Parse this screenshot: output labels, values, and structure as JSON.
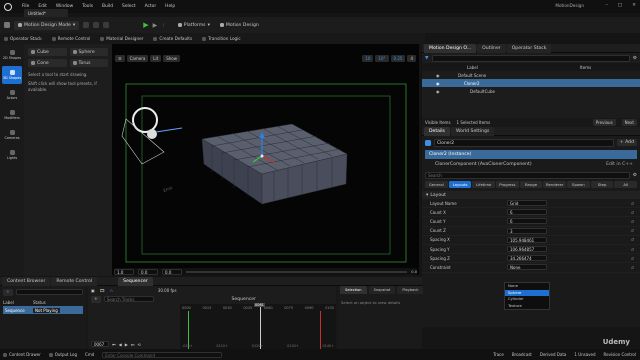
{
  "window": {
    "title": "MotionDesign",
    "doc_tab": "Untitled*"
  },
  "menu": [
    "File",
    "Edit",
    "Window",
    "Tools",
    "Build",
    "Select",
    "Actor",
    "Help"
  ],
  "toolbar": {
    "mode": "Motion Design Mode",
    "platforms": "Platforms",
    "motion_design": "Motion Design"
  },
  "toolbar2": {
    "operator_stack": "Operator Stack",
    "remote_control": "Remote Control",
    "material_designer": "Material Designer",
    "create_defaults": "Create Defaults",
    "transition_logic": "Transition Logic"
  },
  "left_tools": [
    {
      "label": "2D Shapes",
      "icon": "shapes-2d-icon"
    },
    {
      "label": "3D Shapes",
      "icon": "shapes-3d-icon",
      "active": true
    },
    {
      "label": "Actors",
      "icon": "actors-icon"
    },
    {
      "label": "Modifiers",
      "icon": "modifiers-icon"
    },
    {
      "label": "Cameras",
      "icon": "camera-icon"
    },
    {
      "label": "Lights",
      "icon": "light-icon"
    }
  ],
  "shape_buttons": [
    "Cube",
    "Sphere",
    "Cone",
    "Torus"
  ],
  "tool_hint": {
    "line1": "Select a tool to start drawing.",
    "line2": "Shift click will show tool presets, if available."
  },
  "viewport": {
    "camera": "Camera",
    "lit": "Lit",
    "show": "Show",
    "grid": "10",
    "rot": "10°",
    "scale": "0.25",
    "cam_speed": "4",
    "timeline": {
      "start": "1.0",
      "mid": "0.0",
      "sub": "0.0",
      "fps": "0.0"
    },
    "label_3d": "Emit"
  },
  "outliner": {
    "tabs": [
      "Motion Design O...",
      "Outliner",
      "Operator Stack"
    ],
    "col_label": "Label",
    "col_items": "Items",
    "rows": [
      {
        "label": "Default Scene",
        "indent": 1
      },
      {
        "label": "Cloner2",
        "indent": 2,
        "selected": true
      },
      {
        "label": "DefaultCube",
        "indent": 3
      }
    ],
    "footer_left": "Visible Items",
    "footer_mid": "1 Selected Items",
    "previous": "Previous",
    "next": "Next"
  },
  "details": {
    "tabs": [
      "Details",
      "World Settings"
    ],
    "actor_name": "Cloner2",
    "add": "+ Add",
    "instance": "Cloner2 (Instance)",
    "component": "ClonerComponent (AvaClonerComponent)",
    "edit_cpp": "Edit in C++",
    "search_placeholder": "Search",
    "cat_tabs": [
      "General",
      "Layouts",
      "Lifetime",
      "Progress",
      "Range",
      "Renderer",
      "Spawn",
      "Step",
      "All"
    ],
    "section": "Layout",
    "properties": [
      {
        "label": "Layout Name",
        "value": "Grid"
      },
      {
        "label": "Count X",
        "value": "6"
      },
      {
        "label": "Count Y",
        "value": "6"
      },
      {
        "label": "Count Z",
        "value": "3"
      },
      {
        "label": "Spacing X",
        "value": "105.948461"
      },
      {
        "label": "Spacing Y",
        "value": "106.964857"
      },
      {
        "label": "Spacing Z",
        "value": "34.266474"
      },
      {
        "label": "Constraint",
        "value": "None"
      }
    ],
    "dropdown": [
      "None",
      "Sphere",
      "Cylinder",
      "Texture"
    ],
    "dropdown_selected": 1
  },
  "bottom": {
    "tabs_left": [
      "Content Browser",
      "Remote Control"
    ],
    "sequencer_tab": "Sequencer",
    "label_col": "Label",
    "status_col": "Status",
    "sequence_name": "Sequence",
    "not_playing": "Not Playing",
    "sequencer_name": "Sequencer",
    "search_tracks": "Search Tracks",
    "fps": "30.00 fps",
    "frame": "0061",
    "frame_field": "0067",
    "right_tabs": [
      "Selection",
      "Snapshot",
      "Playback"
    ],
    "right_hint": "Select an object to view details",
    "ticks": [
      "0000",
      "0015",
      "0030",
      "0045",
      "0060",
      "0075",
      "0090",
      "0105"
    ],
    "bottom_ticks": [
      "-019+",
      "0110+",
      "0120+",
      "0130+",
      "0140+"
    ]
  },
  "statusbar": {
    "content_drawer": "Content Drawer",
    "output_log": "Output Log",
    "cmd": "Cmd",
    "console_placeholder": "Enter Console Command",
    "trace": "Trace",
    "broadcast": "Broadcast",
    "derived": "Derived Data",
    "unsaved": "1 Unsaved",
    "revision": "Revision Control",
    "udemy": "Udemy"
  },
  "colors": {
    "accent": "#1d6fd1",
    "selected_row": "#3a6a9a",
    "frame_green": "#2f8f3a",
    "timeline_playhead": "#c0c0c0"
  }
}
